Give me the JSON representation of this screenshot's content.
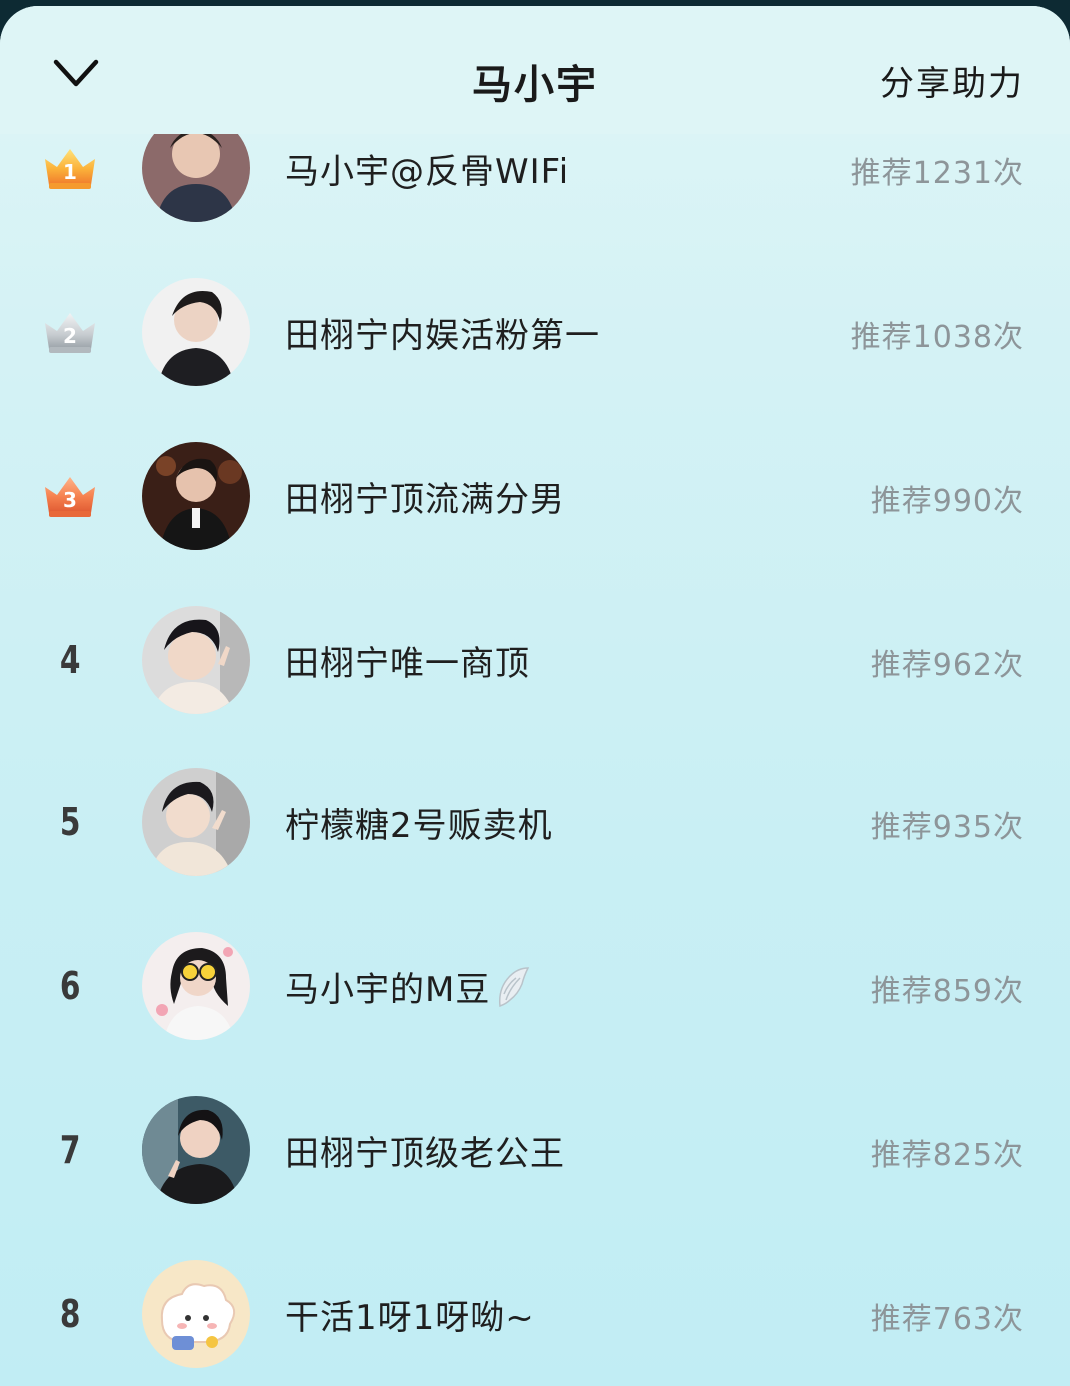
{
  "header": {
    "title": "马小宇",
    "share_label": "分享助力",
    "back_icon": "chevron-down-icon"
  },
  "colors": {
    "gold": "#f5a623",
    "silver": "#c9cdd2",
    "bronze": "#f07b4b",
    "count_text": "#8d9599"
  },
  "rows": [
    {
      "rank": "1",
      "badge": "gold-crown",
      "name": "马小宇@反骨WIFi",
      "count": "推荐1231次",
      "avatar": "avatar-photo"
    },
    {
      "rank": "2",
      "badge": "silver-crown",
      "name": "田栩宁内娱活粉第一",
      "count": "推荐1038次",
      "avatar": "avatar-photo"
    },
    {
      "rank": "3",
      "badge": "bronze-crown",
      "name": "田栩宁顶流满分男",
      "count": "推荐990次",
      "avatar": "avatar-photo"
    },
    {
      "rank": "4",
      "badge": "",
      "name": "田栩宁唯一商顶",
      "count": "推荐962次",
      "avatar": "avatar-photo"
    },
    {
      "rank": "5",
      "badge": "",
      "name": "柠檬糖2号贩卖机",
      "count": "推荐935次",
      "avatar": "avatar-photo"
    },
    {
      "rank": "6",
      "badge": "",
      "name": "马小宇的M豆",
      "count": "推荐859次",
      "avatar": "avatar-photo",
      "suffix_icon": "wing-icon"
    },
    {
      "rank": "7",
      "badge": "",
      "name": "田栩宁顶级老公王",
      "count": "推荐825次",
      "avatar": "avatar-photo"
    },
    {
      "rank": "8",
      "badge": "",
      "name": "干活1呀1呀呦~",
      "count": "推荐763次",
      "avatar": "avatar-cartoon"
    }
  ]
}
